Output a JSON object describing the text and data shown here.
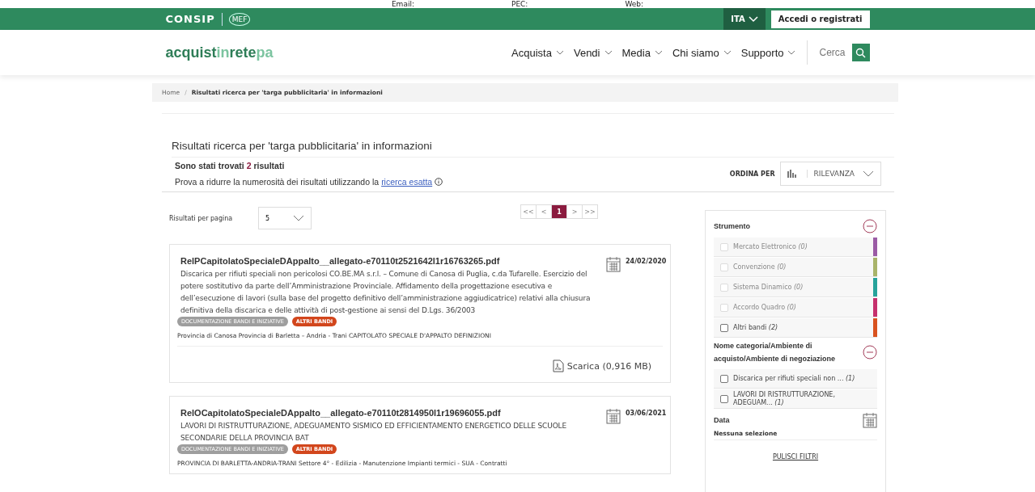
{
  "contact_strip": {
    "labels": [
      "Email:",
      "PEC:",
      "Web:"
    ]
  },
  "top_bar": {
    "logo": "CONSIP",
    "partner": "MEF",
    "language": "ITA",
    "login": "Accedi o registrati"
  },
  "nav": {
    "brand": [
      "acquist",
      "in",
      "rete",
      "pa"
    ],
    "menu": [
      "Acquista",
      "Vendi",
      "Media",
      "Chi siamo",
      "Supporto"
    ],
    "search_label": "Cerca"
  },
  "breadcrumb_separator": "/",
  "breadcrumb": [
    "Home",
    "Risultati ricerca per 'targa pubblicitaria' in informazioni"
  ],
  "title": "Risultati ricerca per 'targa pubblicitaria' in informazioni",
  "summary": {
    "prefix": "Sono stati trovati",
    "count": "2",
    "suffix": "risultati"
  },
  "hint": {
    "text": "Prova a ridurre la numerosità dei risultati utilizzando la",
    "link": "ricerca esatta"
  },
  "sort": {
    "label": "ORDINA PER",
    "value": "RILEVANZA"
  },
  "per_page": {
    "label": "Risultati per pagina",
    "value": "5"
  },
  "pagination": [
    {
      "label": "<<",
      "selected": false
    },
    {
      "label": "<",
      "selected": false
    },
    {
      "label": "1",
      "selected": true
    },
    {
      "label": ">",
      "selected": false
    },
    {
      "label": ">>",
      "selected": false
    }
  ],
  "results": [
    {
      "title": "RelPCapitolatoSpecialeDAppalto__allegato-e70110t2521642l1r16763265.pdf",
      "date": "24/02/2020",
      "description": "Discarica per rifiuti speciali non pericolosi CO.BE.MA s.r.l. – Comune di Canosa di Puglia, c.da Tufarelle. Esercizio del potere sostitutivo da parte dell’Amministrazione Provinciale. Affidamento della progettazione esecutiva e dell’esecuzione di lavori (sulla base del progetto definitivo dell’amministrazione aggiudicatrice) relativi alla chiusura definitiva della discarica e delle attività di post-gestione ai sensi del D.Lgs. 36/2003",
      "tags": [
        {
          "label": "DOCUMENTAZIONE BANDI E INIZIATIVE",
          "kind": "muted"
        },
        {
          "label": "ALTRI BANDI",
          "kind": "active"
        }
      ],
      "keywords": "Provincia di Canosa Provincia di Barletta – Andria - Trani CAPITOLATO SPECIALE D'APPALTO DEFINIZIONI",
      "download": "Scarica (0,916 MB)"
    },
    {
      "title": "RelOCapitolatoSpecialeDAppalto__allegato-e70110t2814950l1r19696055.pdf",
      "date": "03/06/2021",
      "description": "LAVORI DI RISTRUTTURAZIONE, ADEGUAMENTO SISMICO ED EFFICIENTAMENTO ENERGETICO DELLE SCUOLE SECONDARIE DELLA PROVINCIA BAT",
      "tags": [
        {
          "label": "DOCUMENTAZIONE BANDI E INIZIATIVE",
          "kind": "muted"
        },
        {
          "label": "ALTRI BANDI",
          "kind": "active"
        }
      ],
      "keywords": "PROVINCIA DI BARLETTA-ANDRIA-TRANI Settore 4° - Edilizia - Manutenzione Impianti termici - SUA - Contratti"
    }
  ],
  "filters": {
    "groups": [
      {
        "title": "Strumento",
        "expanded": true,
        "options": [
          {
            "label": "Mercato Elettronico",
            "count": "(0)",
            "checked": false,
            "disabled": true,
            "color": "#9b5ba5"
          },
          {
            "label": "Convenzione",
            "count": "(0)",
            "checked": false,
            "disabled": true,
            "color": "#a9b46a"
          },
          {
            "label": "Sistema Dinamico",
            "count": "(0)",
            "checked": false,
            "disabled": true,
            "color": "#27a39b"
          },
          {
            "label": "Accordo Quadro",
            "count": "(0)",
            "checked": false,
            "disabled": true,
            "color": "#c6306d"
          },
          {
            "label": "Altri bandi",
            "count": "(2)",
            "checked": false,
            "disabled": false,
            "color": "#d9521f"
          }
        ]
      },
      {
        "title": "Nome categoria/Ambiente di acquisto/Ambiente di negoziazione",
        "expanded": true,
        "options": [
          {
            "label": "Discarica per rifiuti speciali non ...",
            "count": "(1)",
            "checked": false,
            "disabled": false
          },
          {
            "label": "LAVORI DI RISTRUTTURAZIONE, ADEGUAM...",
            "count": "(1)",
            "checked": false,
            "disabled": false
          }
        ]
      }
    ],
    "date_label": "Data",
    "date_value": "Nessuna selezione",
    "clear": "PULISCI FILTRI"
  }
}
